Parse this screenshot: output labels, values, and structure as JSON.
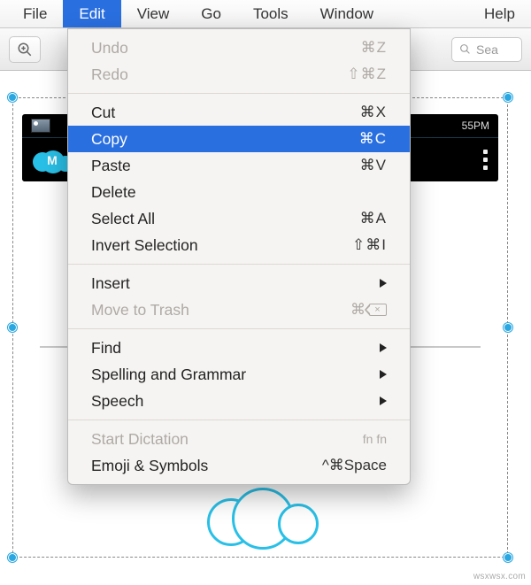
{
  "menubar": {
    "items": [
      {
        "label": "File"
      },
      {
        "label": "Edit"
      },
      {
        "label": "View"
      },
      {
        "label": "Go"
      },
      {
        "label": "Tools"
      },
      {
        "label": "Window"
      },
      {
        "label": "Help"
      }
    ],
    "active_index": 1
  },
  "search": {
    "placeholder": "Sea"
  },
  "dropdown": {
    "groups": [
      [
        {
          "label": "Undo",
          "shortcut": "⌘Z",
          "disabled": true
        },
        {
          "label": "Redo",
          "shortcut": "⇧⌘Z",
          "disabled": true
        }
      ],
      [
        {
          "label": "Cut",
          "shortcut": "⌘X"
        },
        {
          "label": "Copy",
          "shortcut": "⌘C",
          "highlight": true
        },
        {
          "label": "Paste",
          "shortcut": "⌘V"
        },
        {
          "label": "Delete",
          "shortcut": ""
        },
        {
          "label": "Select All",
          "shortcut": "⌘A"
        },
        {
          "label": "Invert Selection",
          "shortcut": "⇧⌘I"
        }
      ],
      [
        {
          "label": "Insert",
          "submenu": true
        },
        {
          "label": "Move to Trash",
          "shortcut": "⌘",
          "del_glyph": true,
          "disabled": true
        }
      ],
      [
        {
          "label": "Find",
          "submenu": true
        },
        {
          "label": "Spelling and Grammar",
          "submenu": true
        },
        {
          "label": "Speech",
          "submenu": true
        }
      ],
      [
        {
          "label": "Start Dictation",
          "shortcut": "fn fn",
          "disabled": true,
          "small_sc": true
        },
        {
          "label": "Emoji & Symbols",
          "shortcut": "^⌘Space"
        }
      ]
    ]
  },
  "canvas": {
    "statusbar_time": "55PM",
    "app_initial": "M"
  },
  "watermark": "wsxwsx.com"
}
